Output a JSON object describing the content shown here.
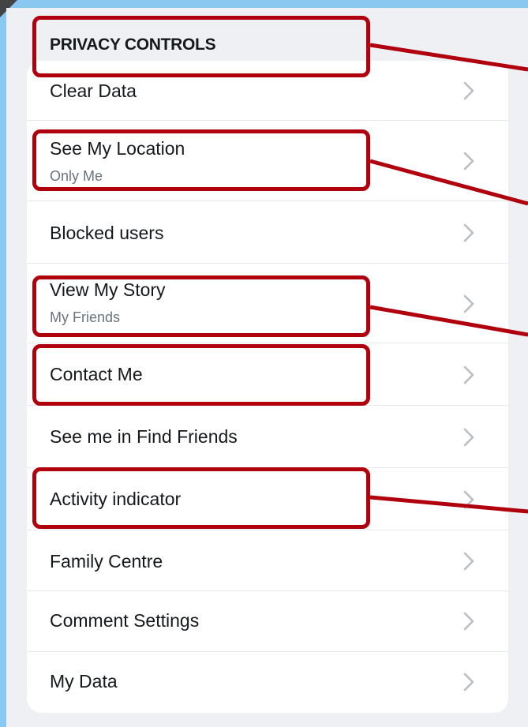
{
  "section": {
    "title": "PRIVACY CONTROLS"
  },
  "rows": [
    {
      "label": "Clear Data",
      "sub": ""
    },
    {
      "label": "See My Location",
      "sub": "Only Me"
    },
    {
      "label": "Blocked users",
      "sub": ""
    },
    {
      "label": "View My Story",
      "sub": "My Friends"
    },
    {
      "label": "Contact Me",
      "sub": ""
    },
    {
      "label": "See me in Find Friends",
      "sub": ""
    },
    {
      "label": "Activity indicator",
      "sub": ""
    },
    {
      "label": "Family Centre",
      "sub": ""
    },
    {
      "label": "Comment Settings",
      "sub": ""
    },
    {
      "label": "My Data",
      "sub": ""
    }
  ],
  "icons": {
    "row_chevron": "chevron-right-icon"
  },
  "colors": {
    "annotation": "#b0000d",
    "background": "#8ac8f2",
    "sub_text": "#6b737d"
  }
}
